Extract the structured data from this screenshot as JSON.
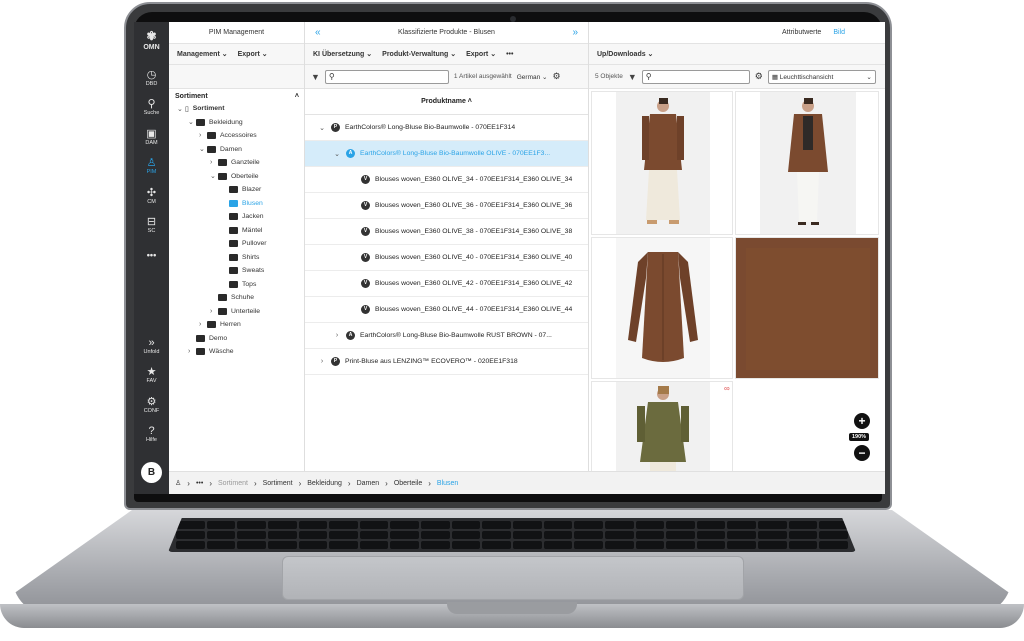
{
  "rail": {
    "logo": "OMN",
    "items": [
      {
        "label": "DBD",
        "icon": "dashboard-icon"
      },
      {
        "label": "Suche",
        "icon": "search-icon"
      },
      {
        "label": "DAM",
        "icon": "image-stack-icon"
      },
      {
        "label": "PIM",
        "icon": "user-data-icon"
      },
      {
        "label": "CM",
        "icon": "network-icon"
      },
      {
        "label": "SC",
        "icon": "cart-icon"
      },
      {
        "label": "•••",
        "icon": "more-icon"
      },
      {
        "label": "Unfold",
        "icon": "unfold-icon"
      },
      {
        "label": "FAV",
        "icon": "star-icon"
      },
      {
        "label": "CONF",
        "icon": "gear-icon"
      },
      {
        "label": "Hilfe",
        "icon": "help-icon"
      }
    ],
    "avatar": "B"
  },
  "panel1": {
    "title": "PIM Management",
    "menu": [
      "Management ⌄",
      "Export ⌄"
    ],
    "tree_title": "Sortiment",
    "tree": [
      {
        "label": "Sortiment",
        "level": 0,
        "chev": "⌄",
        "kind": "doc"
      },
      {
        "label": "Bekleidung",
        "level": 1,
        "chev": "⌄",
        "kind": "folder-open"
      },
      {
        "label": "Accessoires",
        "level": 2,
        "chev": "›",
        "kind": "folder"
      },
      {
        "label": "Damen",
        "level": 2,
        "chev": "⌄",
        "kind": "folder-open"
      },
      {
        "label": "Ganzteile",
        "level": 3,
        "chev": "›",
        "kind": "folder"
      },
      {
        "label": "Oberteile",
        "level": 3,
        "chev": "⌄",
        "kind": "folder-open"
      },
      {
        "label": "Blazer",
        "level": 4,
        "chev": "",
        "kind": "folder"
      },
      {
        "label": "Blusen",
        "level": 4,
        "chev": "",
        "kind": "folder",
        "selected": true
      },
      {
        "label": "Jacken",
        "level": 4,
        "chev": "",
        "kind": "folder"
      },
      {
        "label": "Mäntel",
        "level": 4,
        "chev": "",
        "kind": "folder"
      },
      {
        "label": "Pullover",
        "level": 4,
        "chev": "",
        "kind": "folder"
      },
      {
        "label": "Shirts",
        "level": 4,
        "chev": "",
        "kind": "folder"
      },
      {
        "label": "Sweats",
        "level": 4,
        "chev": "",
        "kind": "folder"
      },
      {
        "label": "Tops",
        "level": 4,
        "chev": "",
        "kind": "folder"
      },
      {
        "label": "Schuhe",
        "level": 3,
        "chev": "",
        "kind": "folder"
      },
      {
        "label": "Unterteile",
        "level": 3,
        "chev": "›",
        "kind": "folder"
      },
      {
        "label": "Herren",
        "level": 2,
        "chev": "›",
        "kind": "folder"
      },
      {
        "label": "Demo",
        "level": 1,
        "chev": "",
        "kind": "folder"
      },
      {
        "label": "Wäsche",
        "level": 1,
        "chev": "›",
        "kind": "folder"
      }
    ]
  },
  "panel2": {
    "title": "Klassifizierte Produkte - Blusen",
    "nav_left": "«",
    "nav_right": "»",
    "menu": [
      "KI Übersetzung ⌄",
      "Produkt-Verwaltung ⌄",
      "Export ⌄",
      "•••"
    ],
    "selection_info": "1 Artikel ausgewählt",
    "language": "German ⌄",
    "column_header": "Produktname ˄",
    "rows": [
      {
        "label": "EarthColors® Long-Bluse Bio-Baumwolle - 070EE1F314",
        "badge": "P",
        "chev": "⌄",
        "indent": 0
      },
      {
        "label": "EarthColors® Long-Bluse Bio-Baumwolle OLIVE - 070EE1F3...",
        "badge": "A",
        "chev": "⌄",
        "indent": 1,
        "selected": true
      },
      {
        "label": "Blouses woven_E360 OLIVE_34 - 070EE1F314_E360 OLIVE_34",
        "badge": "V",
        "chev": "",
        "indent": 2
      },
      {
        "label": "Blouses woven_E360 OLIVE_36 - 070EE1F314_E360 OLIVE_36",
        "badge": "V",
        "chev": "",
        "indent": 2
      },
      {
        "label": "Blouses woven_E360 OLIVE_38 - 070EE1F314_E360 OLIVE_38",
        "badge": "V",
        "chev": "",
        "indent": 2
      },
      {
        "label": "Blouses woven_E360 OLIVE_40 - 070EE1F314_E360 OLIVE_40",
        "badge": "V",
        "chev": "",
        "indent": 2
      },
      {
        "label": "Blouses woven_E360 OLIVE_42 - 070EE1F314_E360 OLIVE_42",
        "badge": "V",
        "chev": "",
        "indent": 2
      },
      {
        "label": "Blouses woven_E360 OLIVE_44 - 070EE1F314_E360 OLIVE_44",
        "badge": "V",
        "chev": "",
        "indent": 2
      },
      {
        "label": "EarthColors® Long-Bluse Bio-Baumwolle RUST BROWN - 07...",
        "badge": "A",
        "chev": "›",
        "indent": 1
      },
      {
        "label": "Print-Bluse aus LENZING™ ECOVERO™ - 020EE1F318",
        "badge": "P",
        "chev": "›",
        "indent": 0
      }
    ]
  },
  "panel3": {
    "tabs": [
      "Attributwerte",
      "Bild"
    ],
    "active_tab": "Bild",
    "menu": [
      "Up/Downloads ⌄"
    ],
    "object_count": "5 Objekte",
    "view_select": "Leuchttischansicht",
    "zoom": "190%"
  },
  "breadcrumb": [
    "•••",
    "Sortiment",
    "Sortiment",
    "Bekleidung",
    "Damen",
    "Oberteile",
    "Blusen"
  ],
  "colors": {
    "accent": "#2aa3e6",
    "rail_bg": "#2f3033",
    "selected_row": "#d5ecfa",
    "blouse_brown": "#7b4a2f",
    "blouse_olive": "#6b6b3e"
  }
}
